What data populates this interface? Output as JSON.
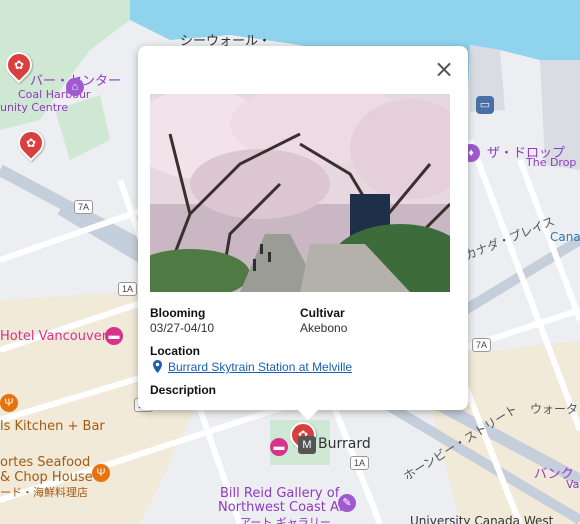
{
  "map": {
    "labels": {
      "seawall": "シーウォール・",
      "harbour_centre_jp": "バー・センター",
      "harbour_centre_en1": "Coal Harbour",
      "harbour_centre_en2": "unity Centre",
      "the_drop_jp": "ザ・ドロップ",
      "the_drop_en": "The Drop",
      "canada_place_jp": "カナダ・プレイス",
      "canada": "Cana",
      "hotel_vancouver": "Hotel Vancouver",
      "kitchen_bar": "ls Kitchen + Bar",
      "cortes_1": "ortes Seafood",
      "cortes_2": "& Chop House",
      "cortes_jp": "ード・海鮮料理店",
      "burrard": "Burrard",
      "hornby_jp": "ホーンビー・ストリート",
      "water_st_jp": "ウォータ",
      "bank_jp": "バンク",
      "bank_en": "Va",
      "bill_reid_1": "Bill Reid Gallery of",
      "bill_reid_2": "Northwest Coast Art",
      "bill_reid_jp": "アート ギャラリー",
      "university": "University Canada West"
    },
    "shields": {
      "s7a_1": "7A",
      "s1a_1": "1A",
      "s7a_2": "7A",
      "s1a_2": "1A",
      "s1a_3": "1A"
    },
    "colors": {
      "water": "#8fd3ec",
      "land": "#eceef1",
      "park": "#cfe8d4",
      "road": "#ffffff",
      "major_road": "#c5cedb",
      "accent_pin": "#d93f3f"
    },
    "icons": {
      "blossom": "flower-icon",
      "hotel": "bed-icon",
      "restaurant": "fork-knife-icon",
      "museum": "palette-icon",
      "transit": "train-icon"
    }
  },
  "popup": {
    "close_label": "×",
    "photo_alt": "cherry blossom trees over a path",
    "blooming_label": "Blooming",
    "blooming_value": "03/27-04/10",
    "cultivar_label": "Cultivar",
    "cultivar_value": "Akebono",
    "location_label": "Location",
    "location_value": "Burrard Skytrain Station at Melville",
    "description_label": "Description"
  }
}
